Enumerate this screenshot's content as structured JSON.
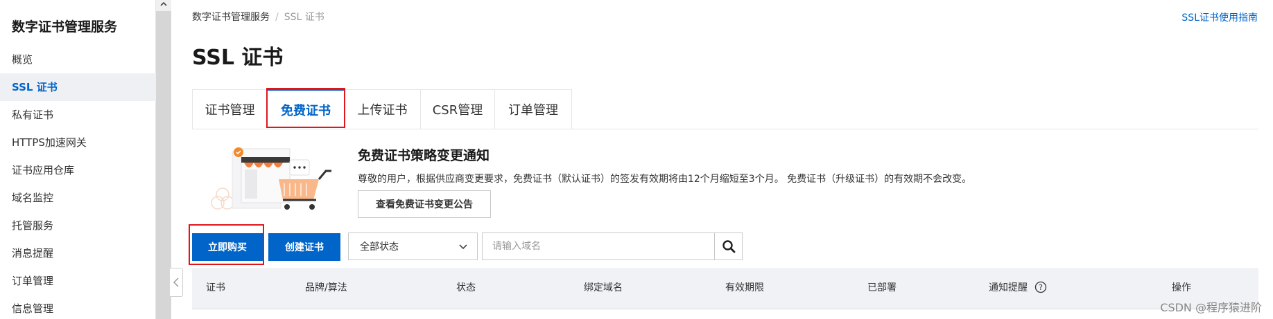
{
  "sidebar": {
    "title": "数字证书管理服务",
    "items": [
      {
        "label": "概览"
      },
      {
        "label": "SSL 证书"
      },
      {
        "label": "私有证书"
      },
      {
        "label": "HTTPS加速网关"
      },
      {
        "label": "证书应用仓库"
      },
      {
        "label": "域名监控"
      },
      {
        "label": "托管服务"
      },
      {
        "label": "消息提醒"
      },
      {
        "label": "订单管理"
      },
      {
        "label": "信息管理"
      }
    ]
  },
  "breadcrumb": {
    "first": "数字证书管理服务",
    "separator": "/",
    "current": "SSL 证书"
  },
  "guide_link": "SSL证书使用指南",
  "page_title": "SSL 证书",
  "tabs": [
    {
      "label": "证书管理"
    },
    {
      "label": "免费证书"
    },
    {
      "label": "上传证书"
    },
    {
      "label": "CSR管理"
    },
    {
      "label": "订单管理"
    }
  ],
  "notice": {
    "title": "免费证书策略变更通知",
    "text": "尊敬的用户，根据供应商变更要求，免费证书（默认证书）的签发有效期将由12个月缩短至3个月。 免费证书（升级证书）的有效期不会改变。",
    "button": "查看免费证书变更公告"
  },
  "toolbar": {
    "buy_button": "立即购买",
    "create_button": "创建证书",
    "status_select": "全部状态",
    "search_placeholder": "请输入域名"
  },
  "table": {
    "columns": [
      "证书",
      "品牌/算法",
      "状态",
      "绑定域名",
      "有效期限",
      "已部署",
      "通知提醒",
      "操作"
    ]
  },
  "colors": {
    "accent": "#0064c8",
    "highlight_box": "#e0161b"
  },
  "watermark": "CSDN @程序猿进阶"
}
